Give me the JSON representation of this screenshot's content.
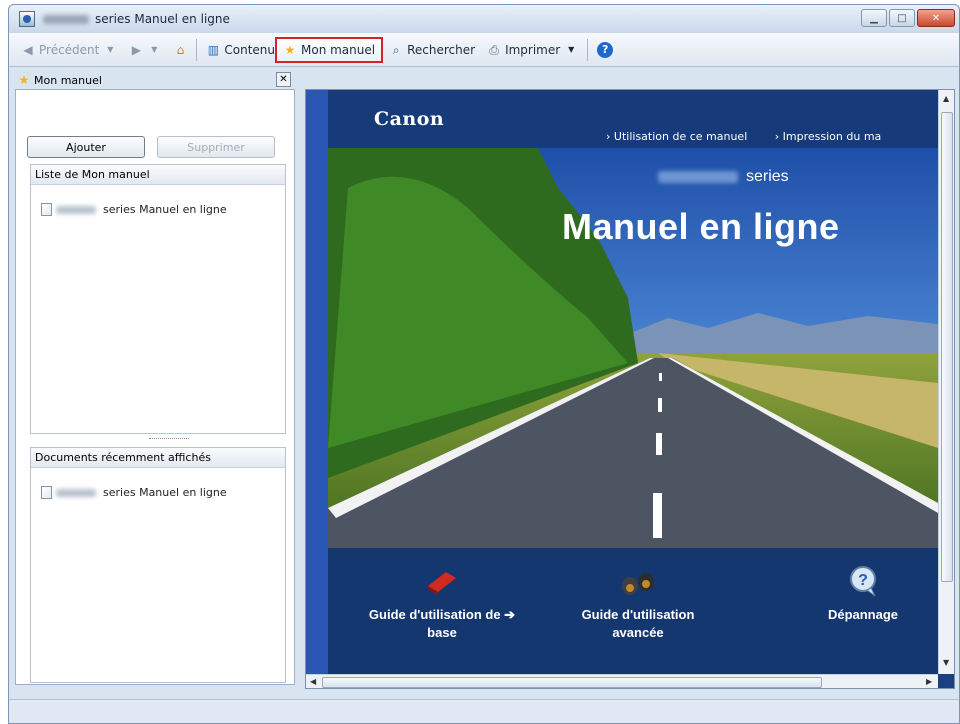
{
  "window": {
    "title_suffix": "series Manuel en ligne"
  },
  "toolbar": {
    "back_label": "Précédent",
    "contents_label": "Contenu",
    "mymanual_label": "Mon manuel",
    "search_label": "Rechercher",
    "print_label": "Imprimer"
  },
  "sidebar": {
    "header": "Mon manuel",
    "add_button": "Ajouter",
    "remove_button": "Supprimer",
    "list_title": "Liste de Mon manuel",
    "list_items": [
      "series Manuel en ligne"
    ],
    "recent_title": "Documents récemment affichés",
    "recent_items": [
      "series Manuel en ligne"
    ]
  },
  "content": {
    "brand": "Canon",
    "link_usage": "Utilisation de ce manuel",
    "link_print": "Impression du ma",
    "series_label": "series",
    "hero_title": "Manuel en ligne",
    "nav": [
      {
        "line1": "Guide d'utilisation de",
        "line2": "base"
      },
      {
        "line1": "Guide d'utilisation",
        "line2": "avancée"
      },
      {
        "line1": "Dépannage",
        "line2": ""
      }
    ]
  },
  "colors": {
    "highlight_border": "#d8222a",
    "content_bg": "#1b3f83"
  }
}
